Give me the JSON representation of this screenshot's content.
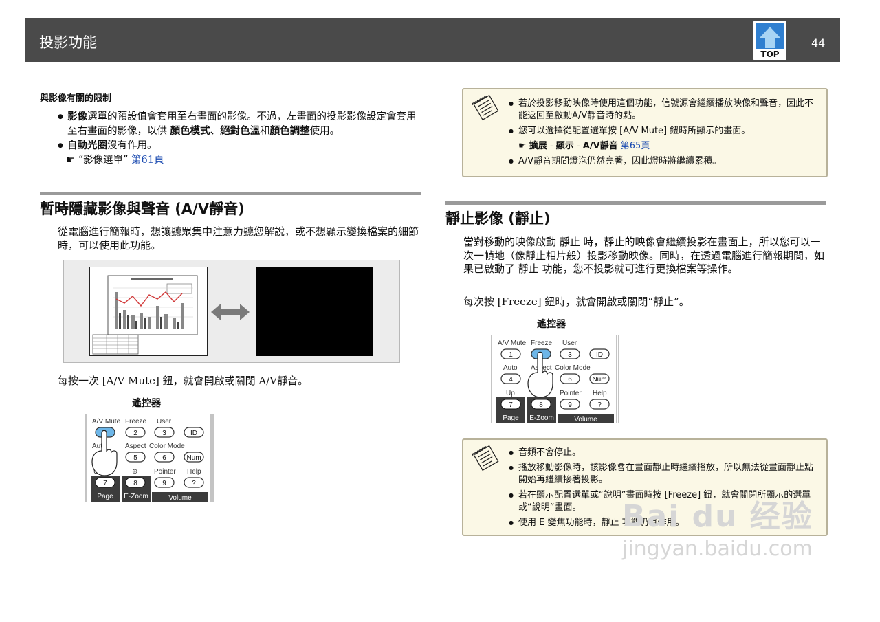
{
  "header": {
    "title": "投影功能",
    "top_label": "TOP",
    "page_number": "44"
  },
  "left": {
    "subhead": "與影像有關的限制",
    "bullets": [
      {
        "b1": "影像",
        "t1": "選單的預設值會套用至右畫面的影像。不過，左畫面的投影影像設定會套用至右畫面的影像，以供 ",
        "b2": "顏色模式",
        "t2": "、",
        "b3": "絕對色溫",
        "t3": "和",
        "b4": "顏色調整",
        "t4": "使用。"
      },
      {
        "b1": "自動光圈",
        "t1": "沒有作用。"
      }
    ],
    "ref": {
      "hand": "☛",
      "text": "“影像選單”",
      "link": "第61頁"
    },
    "section_title": "暫時隱藏影像與聲音 (A/V靜音)",
    "section_para": "從電腦進行簡報時，想讓聽眾集中注意力聽您解說，或不想顯示變換檔案的細節時，可以使用此功能。",
    "press_text": "每按一次 [A/V  Mute] 鈕，就會開啟或關閉 A/V靜音。",
    "remote_label": "遙控器"
  },
  "right": {
    "note1": [
      "若於投影移動映像時使用這個功能，信號源會繼續播放映像和聲音，因此不能返回至啟動A/V靜音時的點。",
      "您可以選擇從配置選單按 [A/V  Mute] 鈕時所顯示的畫面。",
      "A/V靜音期間燈泡仍然亮著，因此燈時將繼續累積。"
    ],
    "note1_ref": {
      "hand": "☛",
      "b1": "擴展",
      "sep1": " - ",
      "b2": "顯示",
      "sep2": " - ",
      "b3": "A/V靜音",
      "link": "第65頁"
    },
    "section_title": "靜止影像 (靜止)",
    "section_para": "當對移動的映像啟動 靜止 時，靜止的映像會繼續投影在畫面上，所以您可以一次一幀地（像靜止相片般）投影移動映像。同時，在透過電腦進行簡報期間，如果已啟動了 靜止 功能，您不投影就可進行更換檔案等操作。",
    "press_text": "每次按 [Freeze] 鈕時，就會開啟或關閉“靜止”。",
    "remote_label": "遙控器",
    "note2": [
      "音頻不會停止。",
      "播放移動影像時，該影像會在畫面靜止時繼續播放，所以無法從畫面靜止點開始再繼續接著投影。",
      "若在顯示配置選單或“說明”畫面時按 [Freeze] 鈕，就會關閉所顯示的選單或“說明”畫面。",
      "使用 E 變焦功能時，靜止 功能仍有作用。"
    ]
  },
  "remote": {
    "row1_labels": [
      "A/V Mute",
      "Freeze",
      "User"
    ],
    "row1_keys": [
      "1",
      "2",
      "3",
      "ID"
    ],
    "row2_labels": [
      "Auto",
      "Aspect",
      "Color Mode"
    ],
    "row2_keys": [
      "4",
      "5",
      "6",
      "Num"
    ],
    "row3_labels": [
      "Up",
      "⊕",
      "Pointer",
      "Help"
    ],
    "row3_keys": [
      "7",
      "8",
      "9",
      "?"
    ],
    "row4_labels": [
      "Page",
      "E-Zoom",
      "Volume"
    ]
  },
  "watermark": {
    "logo": "Bai du 经验",
    "url": "jingyan.baidu.com"
  },
  "colors": {
    "header_bg": "#4a4a4a",
    "top_button": "#2f7fd0",
    "note_bg": "#fbf8e6",
    "link": "#1a4ab0",
    "key_highlight": "#6db6e8"
  }
}
